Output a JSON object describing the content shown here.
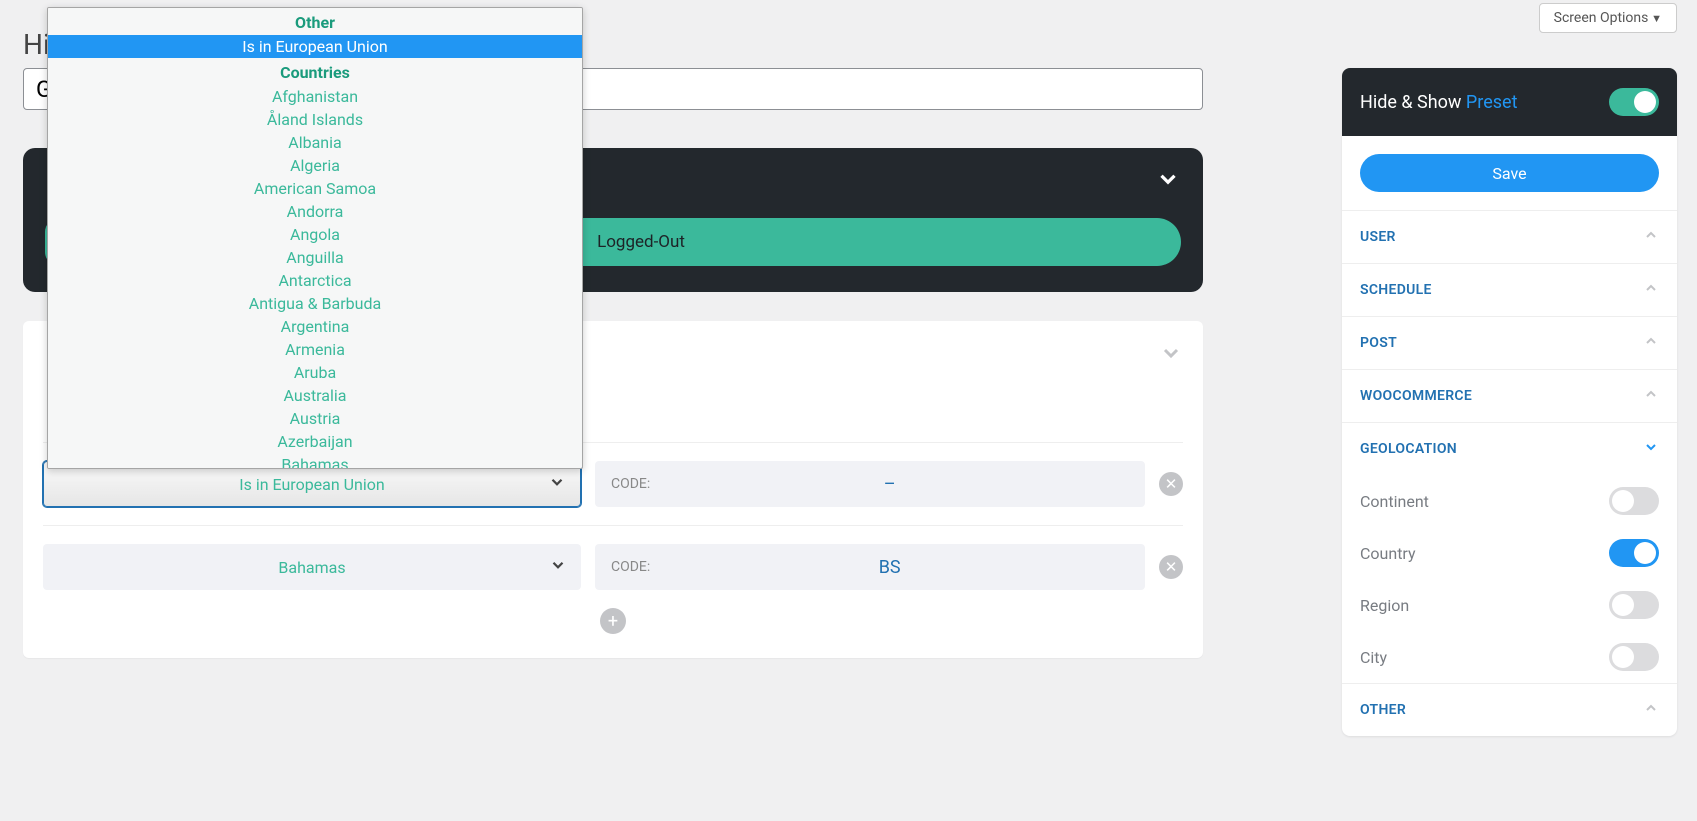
{
  "screen_options": "Screen Options",
  "title_partial": "Hi",
  "title_value": "G",
  "logged_out": "Logged-Out",
  "dropdown": {
    "group1": "Other",
    "selected": "Is in European Union",
    "group2": "Countries",
    "items": [
      "Afghanistan",
      "Åland Islands",
      "Albania",
      "Algeria",
      "American Samoa",
      "Andorra",
      "Angola",
      "Anguilla",
      "Antarctica",
      "Antigua & Barbuda",
      "Argentina",
      "Armenia",
      "Aruba",
      "Australia",
      "Austria",
      "Azerbaijan",
      "Bahamas"
    ]
  },
  "rows": [
    {
      "select": "Is in European Union",
      "code_label": "CODE:",
      "code_value": "–"
    },
    {
      "select": "Bahamas",
      "code_label": "CODE:",
      "code_value": "BS"
    }
  ],
  "sidebar": {
    "title_a": "Hide & Show ",
    "title_b": "Preset",
    "save": "Save",
    "sections": {
      "user": "USER",
      "schedule": "SCHEDULE",
      "post": "POST",
      "woocommerce": "WOOCOMMERCE",
      "geolocation": "GEOLOCATION",
      "other": "OTHER"
    },
    "geo": {
      "continent": "Continent",
      "country": "Country",
      "region": "Region",
      "city": "City"
    }
  }
}
